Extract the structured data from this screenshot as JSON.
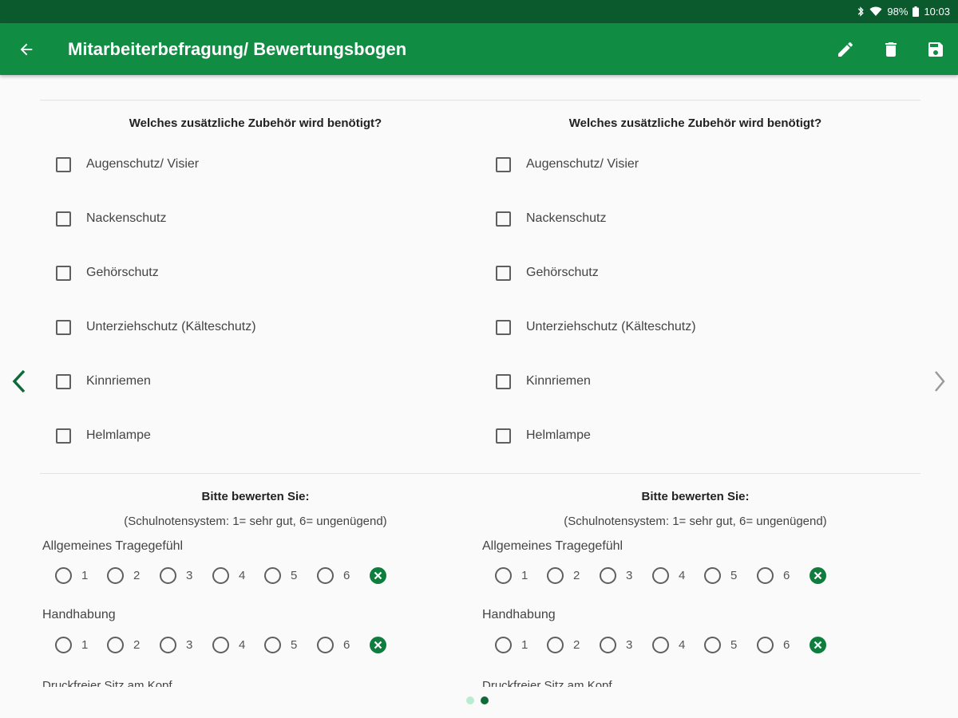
{
  "statusbar": {
    "battery": "98%",
    "time": "10:03"
  },
  "appbar": {
    "title": "Mitarbeiterbefragung/ Bewertungsbogen",
    "bg_color": "#118c43",
    "statusbar_color": "#0b5a2e"
  },
  "columns": [
    {
      "question": "Welches zusätzliche Zubehör wird benötigt?",
      "checkboxes": [
        {
          "label": "Augenschutz/ Visier",
          "checked": false
        },
        {
          "label": "Nackenschutz",
          "checked": false
        },
        {
          "label": "Gehörschutz",
          "checked": false
        },
        {
          "label": "Unterziehschutz (Kälteschutz)",
          "checked": false
        },
        {
          "label": "Kinnriemen",
          "checked": false
        },
        {
          "label": "Helmlampe",
          "checked": false
        }
      ],
      "rating_title": "Bitte bewerten Sie:",
      "rating_subtitle": "(Schulnotensystem: 1= sehr gut, 6= ungenügend)",
      "ratings": [
        {
          "label": "Allgemeines Tragegefühl",
          "options": [
            "1",
            "2",
            "3",
            "4",
            "5",
            "6"
          ]
        },
        {
          "label": "Handhabung",
          "options": [
            "1",
            "2",
            "3",
            "4",
            "5",
            "6"
          ]
        }
      ],
      "cutoff_label": "Druckfreier Sitz am Kopf"
    },
    {
      "question": "Welches zusätzliche Zubehör wird benötigt?",
      "checkboxes": [
        {
          "label": "Augenschutz/ Visier",
          "checked": false
        },
        {
          "label": "Nackenschutz",
          "checked": false
        },
        {
          "label": "Gehörschutz",
          "checked": false
        },
        {
          "label": "Unterziehschutz (Kälteschutz)",
          "checked": false
        },
        {
          "label": "Kinnriemen",
          "checked": false
        },
        {
          "label": "Helmlampe",
          "checked": false
        }
      ],
      "rating_title": "Bitte bewerten Sie:",
      "rating_subtitle": "(Schulnotensystem: 1= sehr gut, 6= ungenügend)",
      "ratings": [
        {
          "label": "Allgemeines Tragegefühl",
          "options": [
            "1",
            "2",
            "3",
            "4",
            "5",
            "6"
          ]
        },
        {
          "label": "Handhabung",
          "options": [
            "1",
            "2",
            "3",
            "4",
            "5",
            "6"
          ]
        }
      ],
      "cutoff_label": "Druckfreier Sitz am Kopf"
    }
  ],
  "pager": {
    "page_count": 2,
    "active_index": 1
  },
  "colors": {
    "accent": "#0e7d3e",
    "dot_inactive": "#b9ecd0",
    "dot_active": "#0e6b38"
  }
}
